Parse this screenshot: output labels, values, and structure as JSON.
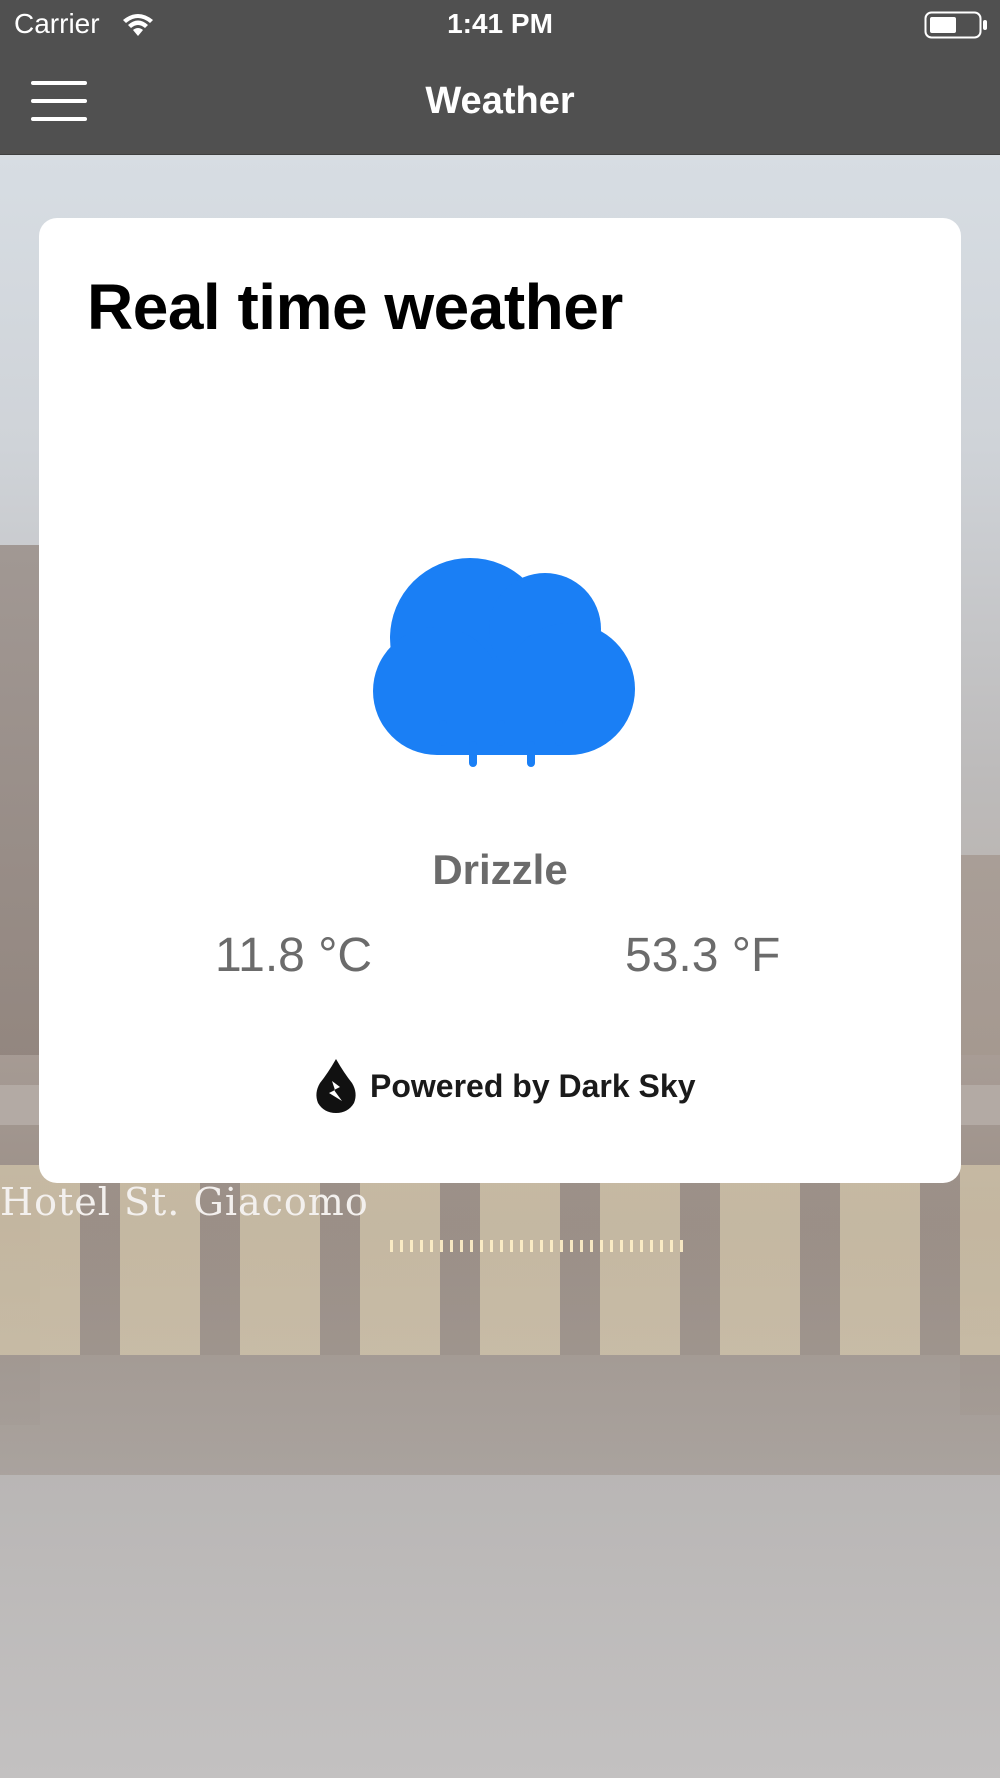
{
  "status_bar": {
    "carrier": "Carrier",
    "time": "1:41 PM",
    "wifi_icon": "wifi-icon",
    "battery_icon": "battery-icon"
  },
  "nav": {
    "title": "Weather",
    "menu_icon": "hamburger-menu-icon"
  },
  "background": {
    "sign_text": "Hotel St. Giacomo"
  },
  "card": {
    "title": "Real time weather",
    "icon": "rain-cloud-icon",
    "icon_color": "#1a7ff5",
    "condition": "Drizzle",
    "temp_c": "11.8 °C",
    "temp_f": "53.3 °F",
    "powered_by": "Powered by Dark Sky",
    "powered_icon": "dark-sky-logo-icon"
  },
  "colors": {
    "bar": "#505050",
    "accent": "#1a7ff5",
    "muted_text": "#6b6b6b"
  }
}
